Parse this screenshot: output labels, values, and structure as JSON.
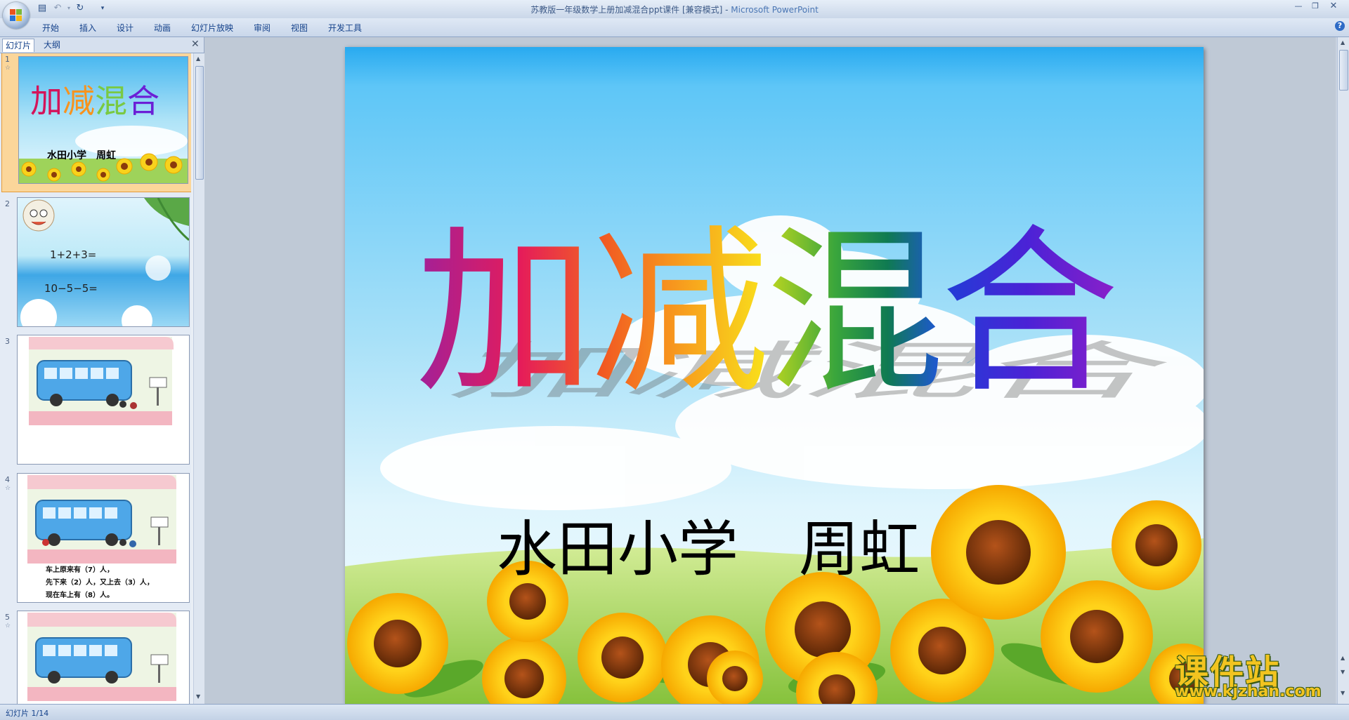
{
  "window": {
    "title": "苏教版一年级数学上册加减混合ppt课件 [兼容模式]",
    "app_name": "Microsoft PowerPoint",
    "separator": " - "
  },
  "quick_access": {
    "save_icon": "save-icon",
    "undo_icon": "undo-icon",
    "redo_icon": "redo-icon",
    "more_icon": "chevron-down-icon"
  },
  "ribbon_tabs": [
    "开始",
    "插入",
    "设计",
    "动画",
    "幻灯片放映",
    "审阅",
    "视图",
    "开发工具"
  ],
  "pane": {
    "tabs": [
      "幻灯片",
      "大纲"
    ],
    "close_label": "✕"
  },
  "thumbnails": [
    {
      "number": "1",
      "title": "加减混合",
      "subtitle": "水田小学　周虹"
    },
    {
      "number": "2",
      "lines": [
        "1+2+3=",
        "10−5−5="
      ]
    },
    {
      "number": "3"
    },
    {
      "number": "4",
      "lines": [
        "车上原来有（7）人，",
        "先下来（2）人，又上去（3）人，",
        "现在车上有（8）人。"
      ]
    },
    {
      "number": "5"
    }
  ],
  "slide": {
    "title_chars": [
      "加",
      "减",
      "混",
      "合"
    ],
    "subtitle": "水田小学　周虹"
  },
  "status": {
    "slide_counter": "幻灯片 1/14"
  },
  "watermark": {
    "title": "课件站",
    "url": "www.kjzhan.com"
  },
  "colors": {
    "title_gradient": [
      "#d4145a",
      "#f7931e",
      "#f9e01b",
      "#7ac943",
      "#1a9a4a",
      "#1f56d6",
      "#6b1fd6"
    ],
    "selection": "#f7a64a"
  }
}
